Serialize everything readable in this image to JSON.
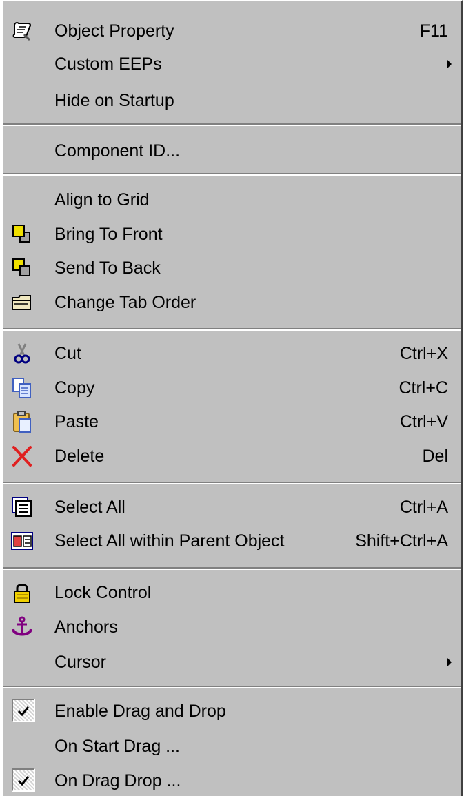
{
  "menu": {
    "object_property": {
      "label": "Object Property",
      "shortcut": "F11",
      "icon": "scroll-icon"
    },
    "custom_eeps": {
      "label": "Custom EEPs"
    },
    "hide_on_startup": {
      "label": "Hide on Startup"
    },
    "component_id": {
      "label": "Component ID..."
    },
    "align_to_grid": {
      "label": "Align to Grid"
    },
    "bring_to_front": {
      "label": "Bring To Front",
      "icon": "bring-to-front-icon"
    },
    "send_to_back": {
      "label": "Send To Back",
      "icon": "send-to-back-icon"
    },
    "change_tab_order": {
      "label": "Change Tab Order",
      "icon": "folder-icon"
    },
    "cut": {
      "label": "Cut",
      "shortcut": "Ctrl+X",
      "icon": "scissors-icon"
    },
    "copy": {
      "label": "Copy",
      "shortcut": "Ctrl+C",
      "icon": "copy-icon"
    },
    "paste": {
      "label": "Paste",
      "shortcut": "Ctrl+V",
      "icon": "clipboard-icon"
    },
    "delete": {
      "label": "Delete",
      "shortcut": "Del",
      "icon": "delete-x-icon"
    },
    "select_all": {
      "label": "Select All",
      "shortcut": "Ctrl+A",
      "icon": "select-all-icon"
    },
    "select_all_within_parent": {
      "label": "Select All within Parent Object",
      "shortcut": "Shift+Ctrl+A",
      "icon": "select-within-parent-icon"
    },
    "lock_control": {
      "label": "Lock Control",
      "icon": "padlock-icon"
    },
    "anchors": {
      "label": "Anchors",
      "icon": "anchor-icon"
    },
    "cursor": {
      "label": "Cursor"
    },
    "enable_drag_and_drop": {
      "label": "Enable Drag and Drop",
      "checked": true
    },
    "on_start_drag": {
      "label": "On Start Drag ..."
    },
    "on_drag_drop": {
      "label": "On Drag Drop ...",
      "checked": true
    }
  },
  "colors": {
    "menu_background": "#c0c0c0",
    "text": "#000000",
    "separator_shadow": "#808080",
    "separator_highlight": "#ffffff",
    "delete_red": "#e02020",
    "lock_yellow": "#f0d000",
    "anchor_purple": "#800080"
  }
}
